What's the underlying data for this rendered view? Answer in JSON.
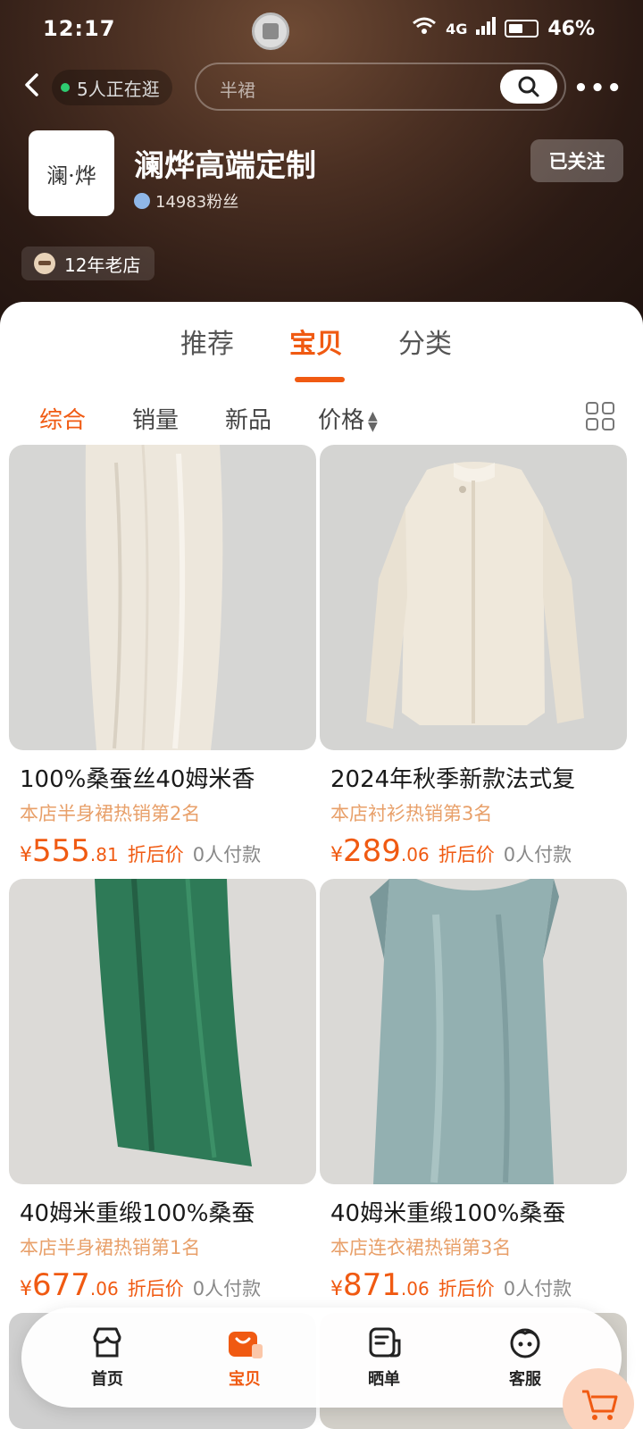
{
  "status": {
    "time": "12:17",
    "network": "4G",
    "battery": "46%"
  },
  "nav": {
    "visitors": "5人正在逛",
    "search_placeholder": "半裙"
  },
  "store": {
    "logo_text": "澜·烨",
    "name": "澜烨高端定制",
    "fans": "14983粉丝",
    "follow_label": "已关注",
    "age_label": "12年老店"
  },
  "tabs": [
    "推荐",
    "宝贝",
    "分类"
  ],
  "active_tab": "宝贝",
  "sort": {
    "items": [
      "综合",
      "销量",
      "新品",
      "价格"
    ],
    "active": "综合"
  },
  "products": [
    {
      "title": "100%桑蚕丝40姆米香",
      "rank": "本店半身裙热销第2名",
      "currency": "¥",
      "price_int": "555",
      "price_dec": ".81",
      "discount_label": "折后价",
      "payers": "0人付款"
    },
    {
      "title": "2024年秋季新款法式复",
      "rank": "本店衬衫热销第3名",
      "currency": "¥",
      "price_int": "289",
      "price_dec": ".06",
      "discount_label": "折后价",
      "payers": "0人付款"
    },
    {
      "title": "40姆米重缎100%桑蚕",
      "rank": "本店半身裙热销第1名",
      "currency": "¥",
      "price_int": "677",
      "price_dec": ".06",
      "discount_label": "折后价",
      "payers": "0人付款"
    },
    {
      "title": "40姆米重缎100%桑蚕",
      "rank": "本店连衣裙热销第3名",
      "currency": "¥",
      "price_int": "871",
      "price_dec": ".06",
      "discount_label": "折后价",
      "payers": "0人付款"
    }
  ],
  "bottom_nav": {
    "items": [
      "首页",
      "宝贝",
      "晒单",
      "客服"
    ],
    "active": "宝贝"
  },
  "colors": {
    "accent": "#f05a12",
    "rank": "#e8a06a",
    "header_dark": "#2b1a14"
  }
}
